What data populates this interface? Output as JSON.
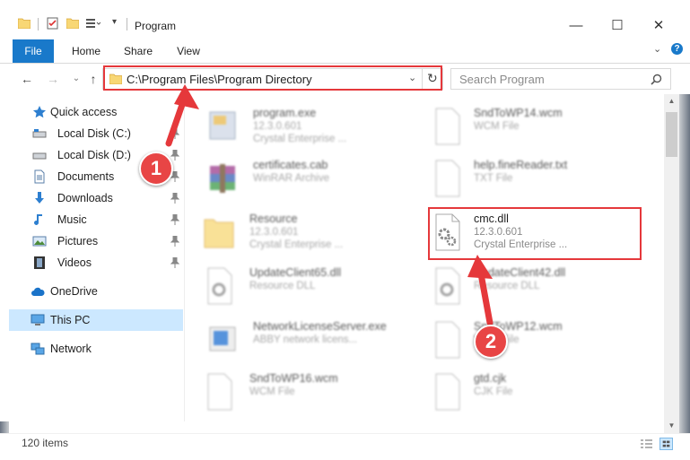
{
  "window": {
    "title": "Program",
    "minimize": "—",
    "maximize": "☐",
    "close": "✕"
  },
  "ribbon": {
    "tabs": [
      {
        "label": "File"
      },
      {
        "label": "Home"
      },
      {
        "label": "Share"
      },
      {
        "label": "View"
      }
    ]
  },
  "address": {
    "path": "C:\\Program Files\\Program Directory",
    "search_placeholder": "Search Program"
  },
  "sidebar": {
    "items": [
      {
        "label": "Quick access"
      },
      {
        "label": "Local Disk (C:)"
      },
      {
        "label": "Local Disk (D:)"
      },
      {
        "label": "Documents"
      },
      {
        "label": "Downloads"
      },
      {
        "label": "Music"
      },
      {
        "label": "Pictures"
      },
      {
        "label": "Videos"
      },
      {
        "label": "OneDrive"
      },
      {
        "label": "This PC"
      },
      {
        "label": "Network"
      }
    ]
  },
  "files": {
    "left": [
      {
        "name": "program.exe",
        "line1": "12.3.0.601",
        "line2": "Crystal Enterprise ..."
      },
      {
        "name": "certificates.cab",
        "line1": "WinRAR Archive",
        "line2": ""
      },
      {
        "name": "Resource",
        "line1": "12.3.0.601",
        "line2": "Crystal Enterprise ..."
      },
      {
        "name": "UpdateClient65.dll",
        "line1": "Resource DLL",
        "line2": ""
      },
      {
        "name": "NetworkLicenseServer.exe",
        "line1": "ABBY network licens...",
        "line2": ""
      },
      {
        "name": "SndToWP16.wcm",
        "line1": "WCM File",
        "line2": ""
      }
    ],
    "right": [
      {
        "name": "SndToWP14.wcm",
        "line1": "WCM File",
        "line2": ""
      },
      {
        "name": "help.fineReader.txt",
        "line1": "TXT File",
        "line2": ""
      },
      {
        "name": "cmc.dll",
        "line1": "12.3.0.601",
        "line2": "Crystal Enterprise ..."
      },
      {
        "name": "UpdateClient42.dll",
        "line1": "Resource DLL",
        "line2": ""
      },
      {
        "name": "SndToWP12.wcm",
        "line1": "WCM File",
        "line2": ""
      },
      {
        "name": "gtd.cjk",
        "line1": "CJK File",
        "line2": ""
      }
    ]
  },
  "status": {
    "count": "120 items"
  },
  "callouts": {
    "one": "1",
    "two": "2"
  },
  "colors": {
    "accent": "#1979ca",
    "callout": "#e5383b",
    "selection": "#cce8ff"
  }
}
